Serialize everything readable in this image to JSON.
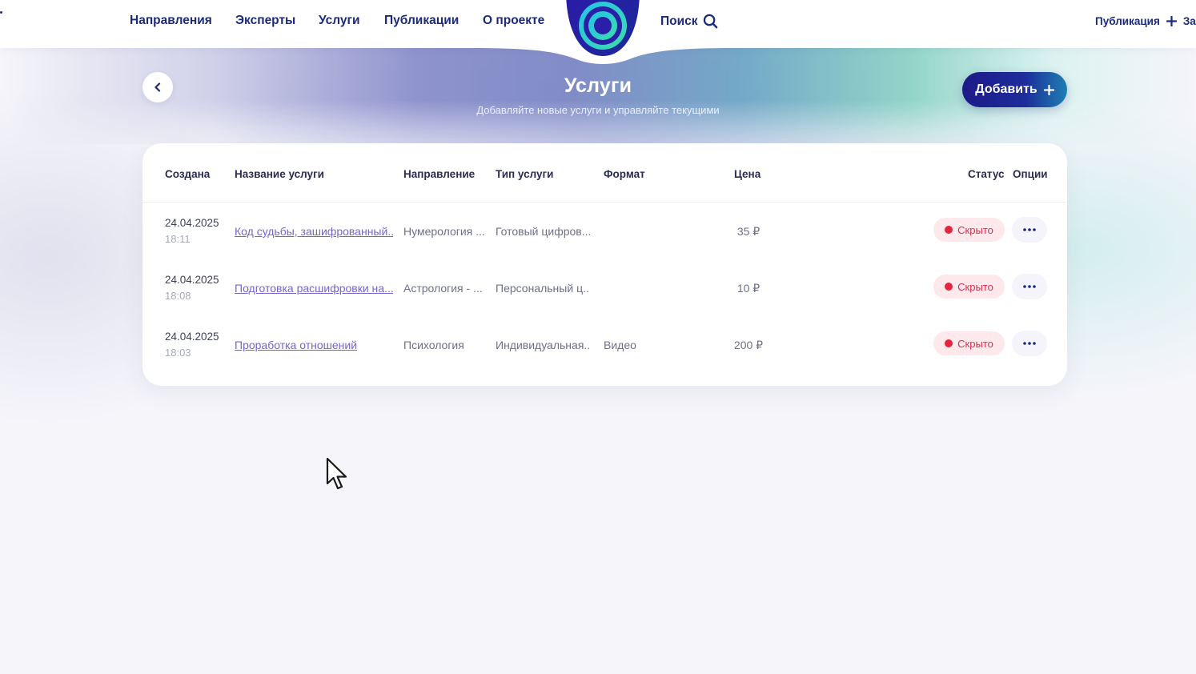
{
  "nav": {
    "items": [
      "Направления",
      "Эксперты",
      "Услуги",
      "Публикации",
      "О проекте"
    ],
    "search_label": "Поиск",
    "publication_label": "Публикация",
    "truncated_right": "За"
  },
  "header": {
    "title": "Услуги",
    "subtitle": "Добавляйте новые услуги и управляйте текущими",
    "add_button": "Добавить"
  },
  "table": {
    "columns": {
      "created": "Создана",
      "name": "Название услуги",
      "direction": "Направление",
      "type": "Тип услуги",
      "format": "Формат",
      "price": "Цена",
      "status": "Статус",
      "options": "Опции"
    },
    "rows": [
      {
        "date": "24.04.2025",
        "time": "18:11",
        "name": "Код судьбы, зашифрованный...",
        "direction": "Нумерология ...",
        "type": "Готовый цифров...",
        "format": "",
        "price": "35 ₽",
        "status": "Скрыто"
      },
      {
        "date": "24.04.2025",
        "time": "18:08",
        "name": "Подготовка расшифровки на...",
        "direction": "Астрология - ...",
        "type": "Персональный ц...",
        "format": "",
        "price": "10 ₽",
        "status": "Скрыто"
      },
      {
        "date": "24.04.2025",
        "time": "18:03",
        "name": "Проработка отношений",
        "direction": "Психология",
        "type": "Индивидуальная...",
        "format": "Видео",
        "price": "200 ₽",
        "status": "Скрыто"
      }
    ]
  },
  "icons": {
    "logo": "concentric-circles-logo-icon",
    "search": "search-icon",
    "plus": "plus-icon",
    "back": "chevron-left-icon",
    "options": "more-horizontal-icon",
    "cursor": "mouse-pointer-icon"
  },
  "colors": {
    "nav_text": "#1b2a7a",
    "accent_dark": "#1d1a88",
    "accent_teal": "#1e7fb2",
    "link": "#7766c8",
    "status_red": "#e5253f",
    "status_bg": "#fde8ec"
  }
}
